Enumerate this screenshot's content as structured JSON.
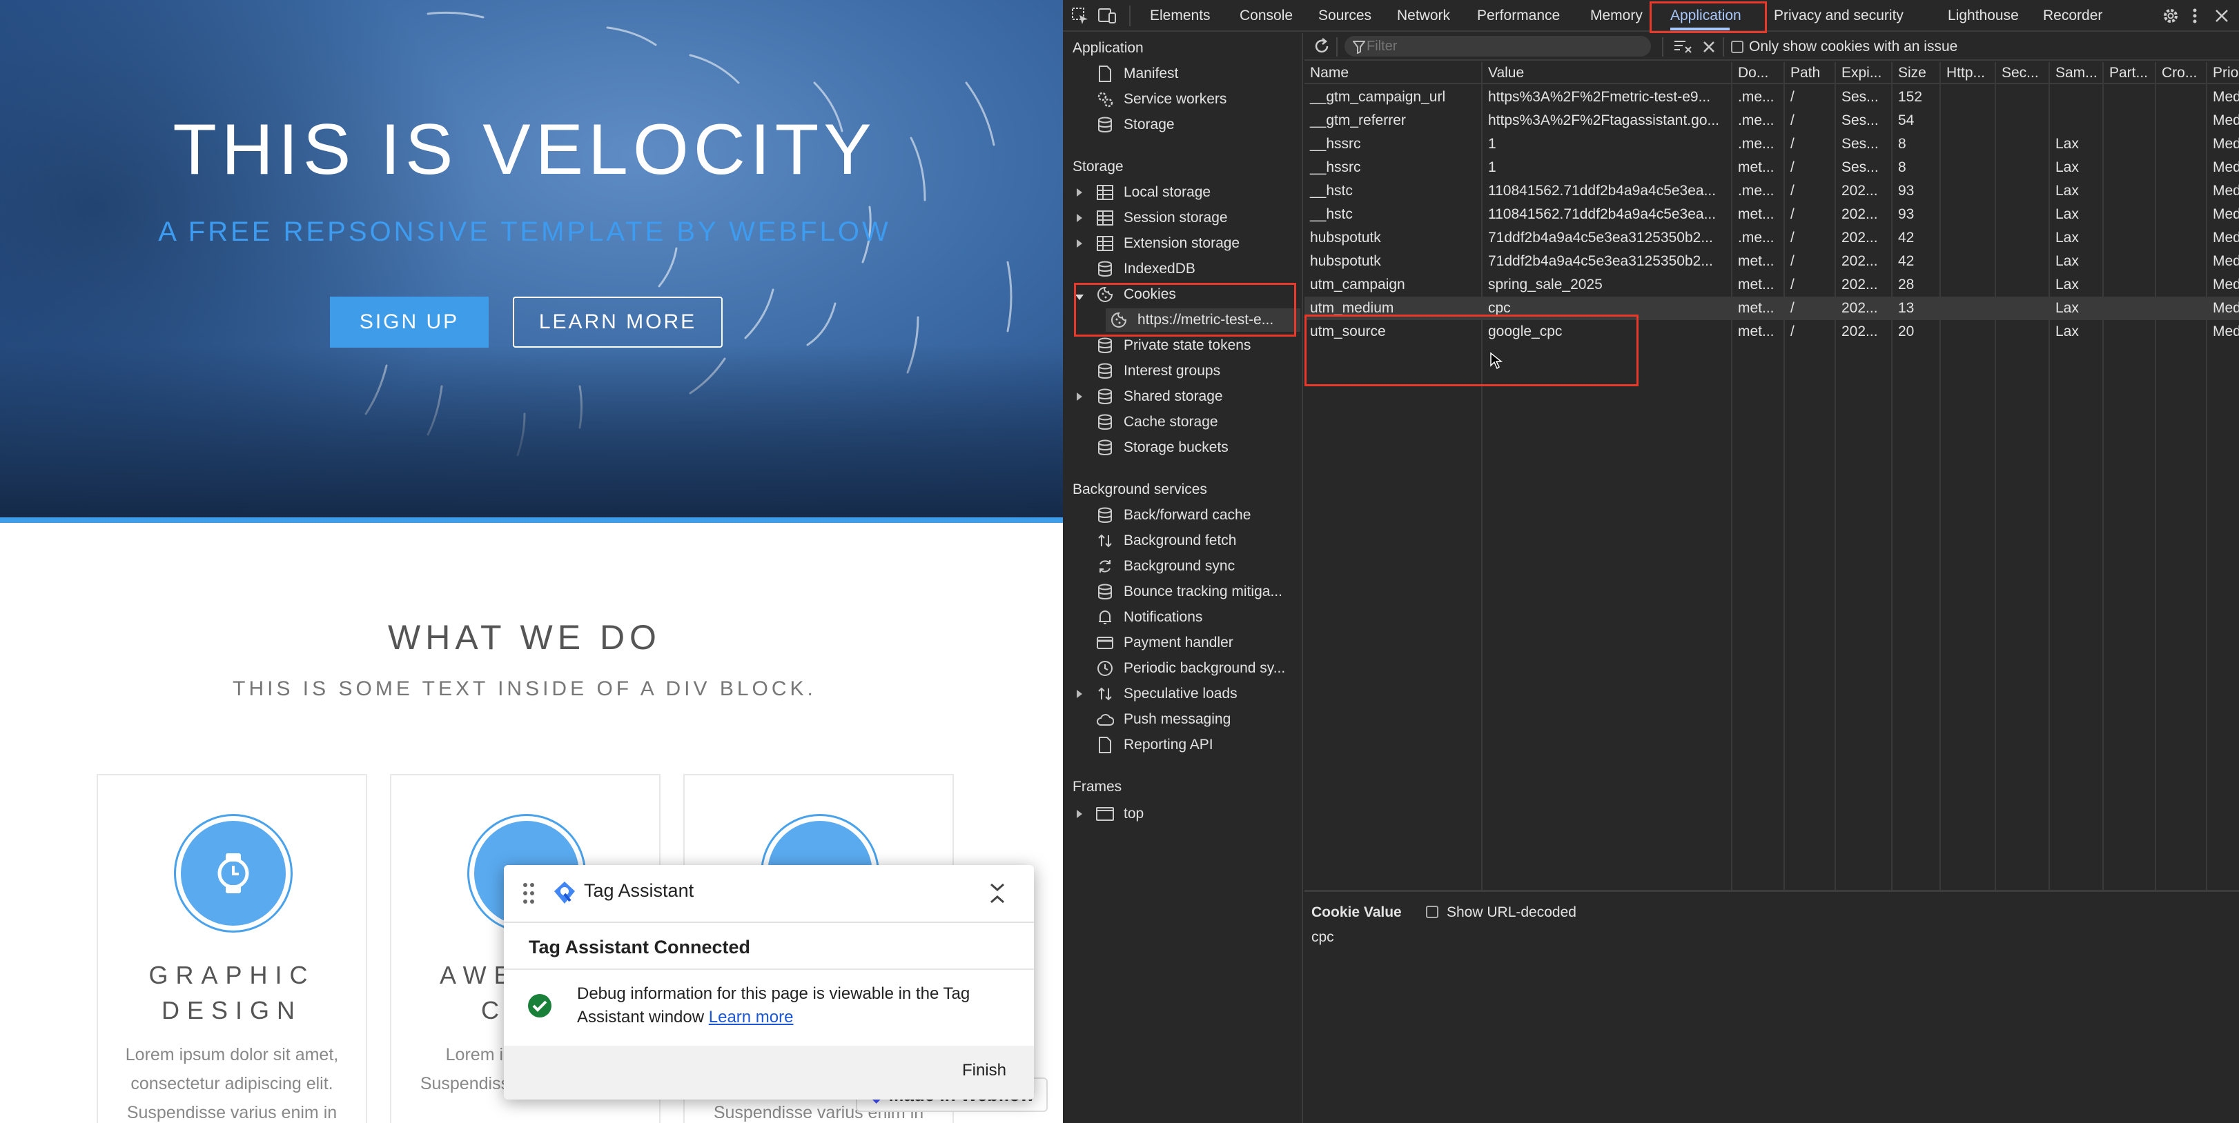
{
  "webpage": {
    "hero_title": "THIS IS VELOCITY",
    "hero_subtitle": "A FREE REPSONSIVE TEMPLATE BY WEBFLOW",
    "signup_label": "SIGN UP",
    "learn_more_label": "LEARN MORE",
    "section_title": "WHAT WE DO",
    "section_subtitle": "THIS IS SOME TEXT INSIDE OF A DIV BLOCK.",
    "cards": [
      {
        "title_line1": "GRAPHIC",
        "title_line2": "DESIGN",
        "text": "Lorem ipsum dolor sit amet, consectetur adipiscing elit. Suspendisse varius enim in"
      },
      {
        "title_line1": "AWE",
        "title_line2": "CO",
        "text": "Lorem ipsu consecte Suspendisse varius enim in"
      },
      {
        "title_line1": "",
        "title_line2": "",
        "text": "Suspendisse varius enim in"
      }
    ],
    "made_in_webflow": "Made in Webflow"
  },
  "tag_assistant": {
    "title": "Tag Assistant",
    "connected": "Tag Assistant Connected",
    "message": "Debug information for this page is viewable in the Tag Assistant window",
    "learn_more": "Learn more",
    "finish": "Finish"
  },
  "devtools": {
    "tabs": [
      "Elements",
      "Console",
      "Sources",
      "Network",
      "Performance",
      "Memory",
      "Application",
      "Privacy and security",
      "Lighthouse",
      "Recorder"
    ],
    "active_tab": "Application",
    "sidebar": {
      "application_header": "Application",
      "application_items": [
        "Manifest",
        "Service workers",
        "Storage"
      ],
      "storage_header": "Storage",
      "storage_items": [
        "Local storage",
        "Session storage",
        "Extension storage",
        "IndexedDB",
        "Cookies",
        "https://metric-test-e...",
        "Private state tokens",
        "Interest groups",
        "Shared storage",
        "Cache storage",
        "Storage buckets"
      ],
      "background_header": "Background services",
      "background_items": [
        "Back/forward cache",
        "Background fetch",
        "Background sync",
        "Bounce tracking mitiga...",
        "Notifications",
        "Payment handler",
        "Periodic background sy...",
        "Speculative loads",
        "Push messaging",
        "Reporting API"
      ],
      "frames_header": "Frames",
      "frames_items": [
        "top"
      ]
    },
    "toolbar": {
      "filter_placeholder": "Filter",
      "only_issues_label": "Only show cookies with an issue"
    },
    "columns": [
      "Name",
      "Value",
      "Do...",
      "Path",
      "Expi...",
      "Size",
      "Http...",
      "Sec...",
      "Sam...",
      "Part...",
      "Cro...",
      "Prio..."
    ],
    "rows": [
      [
        "__gtm_campaign_url",
        "https%3A%2F%2Fmetric-test-e9...",
        ".me...",
        "/",
        "Ses...",
        "152",
        "",
        "",
        "",
        "",
        "",
        "Med..."
      ],
      [
        "__gtm_referrer",
        "https%3A%2F%2Ftagassistant.go...",
        ".me...",
        "/",
        "Ses...",
        "54",
        "",
        "",
        "",
        "",
        "",
        "Med..."
      ],
      [
        "__hssrc",
        "1",
        ".me...",
        "/",
        "Ses...",
        "8",
        "",
        "",
        "Lax",
        "",
        "",
        "Med..."
      ],
      [
        "__hssrc",
        "1",
        "met...",
        "/",
        "Ses...",
        "8",
        "",
        "",
        "Lax",
        "",
        "",
        "Med..."
      ],
      [
        "__hstc",
        "110841562.71ddf2b4a9a4c5e3ea...",
        ".me...",
        "/",
        "202...",
        "93",
        "",
        "",
        "Lax",
        "",
        "",
        "Med..."
      ],
      [
        "__hstc",
        "110841562.71ddf2b4a9a4c5e3ea...",
        "met...",
        "/",
        "202...",
        "93",
        "",
        "",
        "Lax",
        "",
        "",
        "Med..."
      ],
      [
        "hubspotutk",
        "71ddf2b4a9a4c5e3ea3125350b2...",
        ".me...",
        "/",
        "202...",
        "42",
        "",
        "",
        "Lax",
        "",
        "",
        "Med..."
      ],
      [
        "hubspotutk",
        "71ddf2b4a9a4c5e3ea3125350b2...",
        "met...",
        "/",
        "202...",
        "42",
        "",
        "",
        "Lax",
        "",
        "",
        "Med..."
      ],
      [
        "utm_campaign",
        "spring_sale_2025",
        "met...",
        "/",
        "202...",
        "28",
        "",
        "",
        "Lax",
        "",
        "",
        "Med..."
      ],
      [
        "utm_medium",
        "cpc",
        "met...",
        "/",
        "202...",
        "13",
        "",
        "",
        "Lax",
        "",
        "",
        "Med..."
      ],
      [
        "utm_source",
        "google_cpc",
        "met...",
        "/",
        "202...",
        "20",
        "",
        "",
        "Lax",
        "",
        "",
        "Med..."
      ]
    ],
    "selected_row": 9,
    "cookie_value_panel": {
      "title": "Cookie Value",
      "decode_label": "Show URL-decoded",
      "value": "cpc"
    },
    "colors": {
      "highlight": "#e8392b",
      "accent": "#a8c7fa"
    }
  }
}
